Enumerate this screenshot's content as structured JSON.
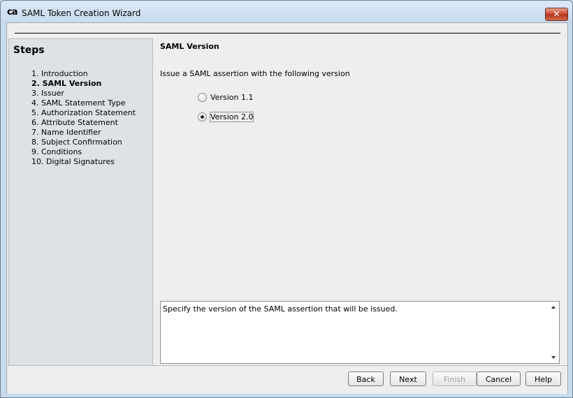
{
  "window": {
    "title": "SAML Token Creation Wizard",
    "logo_text": "ca",
    "close_glyph": "✕"
  },
  "steps": {
    "title": "Steps",
    "items": [
      {
        "label": "1. Introduction",
        "current": false
      },
      {
        "label": "2. SAML Version",
        "current": true
      },
      {
        "label": "3. Issuer",
        "current": false
      },
      {
        "label": "4. SAML Statement Type",
        "current": false
      },
      {
        "label": "5. Authorization Statement",
        "current": false
      },
      {
        "label": "6. Attribute Statement",
        "current": false
      },
      {
        "label": "7. Name Identifier",
        "current": false
      },
      {
        "label": "8. Subject Confirmation",
        "current": false
      },
      {
        "label": "9. Conditions",
        "current": false
      },
      {
        "label": "10. Digital Signatures",
        "current": false
      }
    ]
  },
  "main": {
    "section_title": "SAML Version",
    "prompt": "Issue a SAML assertion with the following version",
    "options": [
      {
        "label": "Version 1.1",
        "selected": false
      },
      {
        "label": "Version 2.0",
        "selected": true
      }
    ],
    "help_text": "Specify the version of the SAML assertion that will be issued."
  },
  "buttons": {
    "back": "Back",
    "next": "Next",
    "finish": "Finish",
    "cancel": "Cancel",
    "help": "Help"
  }
}
